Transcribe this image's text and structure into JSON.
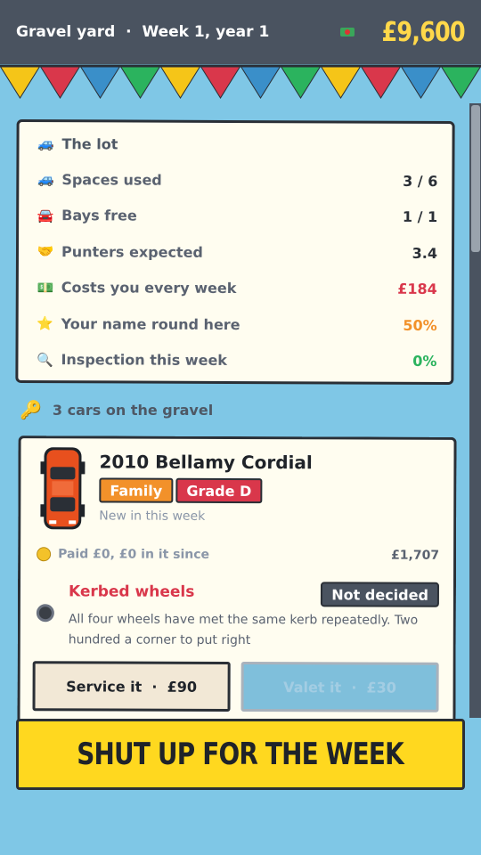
{
  "header": {
    "yard": "Gravel yard",
    "separator": "·",
    "week": "Week 1, year 1",
    "money": "£9,600",
    "money_icon": "banknote-icon"
  },
  "bunting_colors": [
    "#f5c518",
    "#d9374b",
    "#3a8fc9",
    "#2bb35e"
  ],
  "lot": {
    "title": "The lot",
    "rows": [
      {
        "icon": "car-icon",
        "label": "Spaces used",
        "value": "3 / 6",
        "color": "default"
      },
      {
        "icon": "garage-icon",
        "label": "Bays free",
        "value": "1 / 1",
        "color": "default"
      },
      {
        "icon": "handshake-icon",
        "label": "Punters expected",
        "value": "3.4",
        "color": "default"
      },
      {
        "icon": "banknote-icon",
        "label": "Costs you every week",
        "value": "£184",
        "color": "red"
      },
      {
        "icon": "star-icon",
        "label": "Your name round here",
        "value": "50%",
        "color": "orange"
      },
      {
        "icon": "magnifier-icon",
        "label": "Inspection this week",
        "value": "0%",
        "color": "green"
      }
    ]
  },
  "cars_heading": "3 cars on the gravel",
  "car": {
    "title": "2010 Bellamy Cordial",
    "tag_family": "Family",
    "tag_grade": "Grade D",
    "status": "New in this week",
    "paid_text": "Paid £0, £0 in it since",
    "value": "£1,707",
    "issue_title": "Kerbed wheels",
    "decision": "Not decided",
    "issue_desc": "All four wheels have met the same kerb repeatedly. Two hundred a corner to put right",
    "service_label": "Service it",
    "service_price": "£90",
    "valet_label": "Valet it",
    "valet_price": "£30",
    "color": "#e8501e"
  },
  "shut_button": "SHUT UP FOR THE WEEK"
}
